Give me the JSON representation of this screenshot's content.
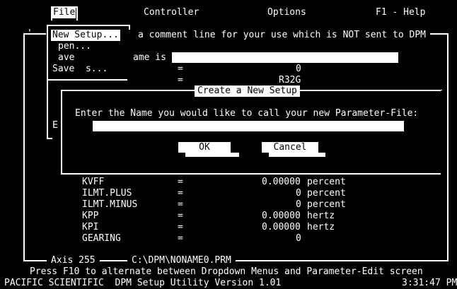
{
  "menubar": {
    "file": "File",
    "controller": "Controller",
    "options": "Options",
    "help": "F1 - Help"
  },
  "file_menu": {
    "items": [
      "New Setup...",
      "pen...",
      "ave",
      "Save  s..."
    ],
    "hidden_item": "E"
  },
  "main_panel": {
    "comment_prefix": "'",
    "comment_text": "a comment line for your use which is NOT sent to DPM",
    "name_label": "ame is",
    "name_value": "",
    "row1_eq": "=",
    "row1_value": "0",
    "row2_eq": "=",
    "row2_value": "R32G"
  },
  "dialog": {
    "title": "Create a New Setup",
    "prompt": "Enter the Name you would like to call your new Parameter-File:",
    "input_value": "",
    "ok_label": "OK",
    "cancel_label": "Cancel"
  },
  "params": [
    {
      "name": "KVFF",
      "eq": "=",
      "value": "0.00000",
      "unit": "percent"
    },
    {
      "name": "ILMT.PLUS",
      "eq": "=",
      "value": "0",
      "unit": "percent"
    },
    {
      "name": "ILMT.MINUS",
      "eq": "=",
      "value": "0",
      "unit": "percent"
    },
    {
      "name": "KPP",
      "eq": "=",
      "value": "0.00000",
      "unit": "hertz"
    },
    {
      "name": "KPI",
      "eq": "=",
      "value": "0.00000",
      "unit": "hertz"
    },
    {
      "name": "GEARING",
      "eq": "=",
      "value": "0",
      "unit": ""
    }
  ],
  "footer": {
    "axis": "Axis 255",
    "path": "C:\\DPM\\NONAME0.PRM",
    "hint": "Press F10 to alternate between Dropdown Menus and Parameter-Edit screen",
    "product": "PACIFIC SCIENTIFIC  DPM Setup Utility Version 1.01",
    "time": "3:31:47 PM"
  }
}
